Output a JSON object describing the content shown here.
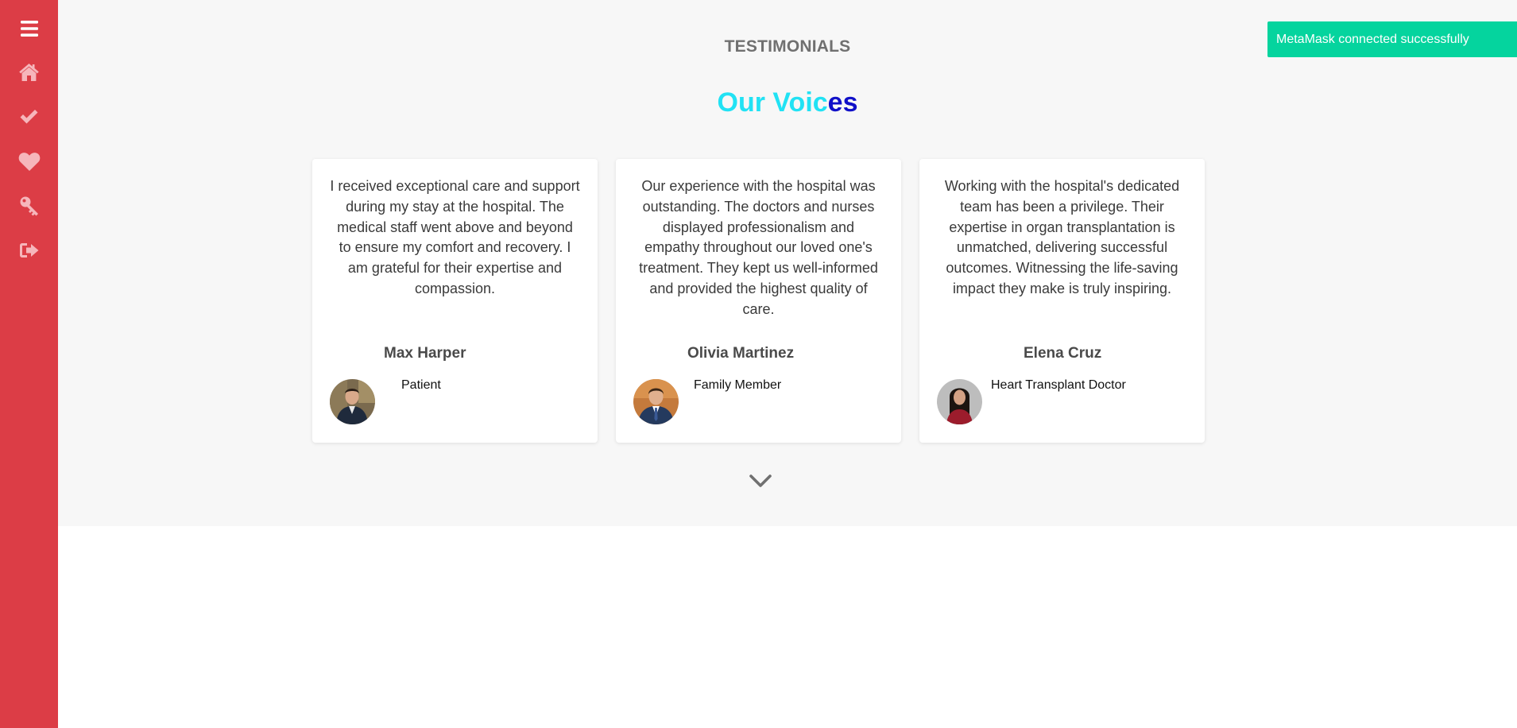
{
  "sidebar": {
    "items": [
      {
        "icon": "hamburger-menu-icon"
      },
      {
        "icon": "home-icon"
      },
      {
        "icon": "checkmark-icon"
      },
      {
        "icon": "heart-icon"
      },
      {
        "icon": "key-icon"
      },
      {
        "icon": "sign-out-icon"
      }
    ],
    "color": "#dc3d46",
    "icon_color_active": "#ffffff",
    "icon_color": "#f6b6bb"
  },
  "section": {
    "label": "TESTIMONIALS",
    "heading_main": "Our Voic",
    "heading_tail": "es",
    "heading_color": "#21e2f4",
    "heading_tail_color": "#1010c8"
  },
  "testimonials": [
    {
      "quote": "I received exceptional care and support during my stay at the hospital. The medical staff went above and beyond to ensure my comfort and recovery. I am grateful for their expertise and compassion.",
      "name": "Max Harper",
      "role": "Patient"
    },
    {
      "quote": "Our experience with the hospital was outstanding. The doctors and nurses displayed professionalism and empathy throughout our loved one's treatment. They kept us well-informed and provided the highest quality of care.",
      "name": "Olivia Martinez",
      "role": "Family Member"
    },
    {
      "quote": "Working with the hospital's dedicated team has been a privilege. Their expertise in organ transplantation is unmatched, delivering successful outcomes. Witnessing the life-saving impact they make is truly inspiring.",
      "name": "Elena Cruz",
      "role": "Heart Transplant Doctor"
    }
  ],
  "scroll_indicator": {
    "icon": "chevron-down-icon"
  },
  "toast": {
    "message": "MetaMask connected successfully",
    "color": "#05d49e"
  }
}
